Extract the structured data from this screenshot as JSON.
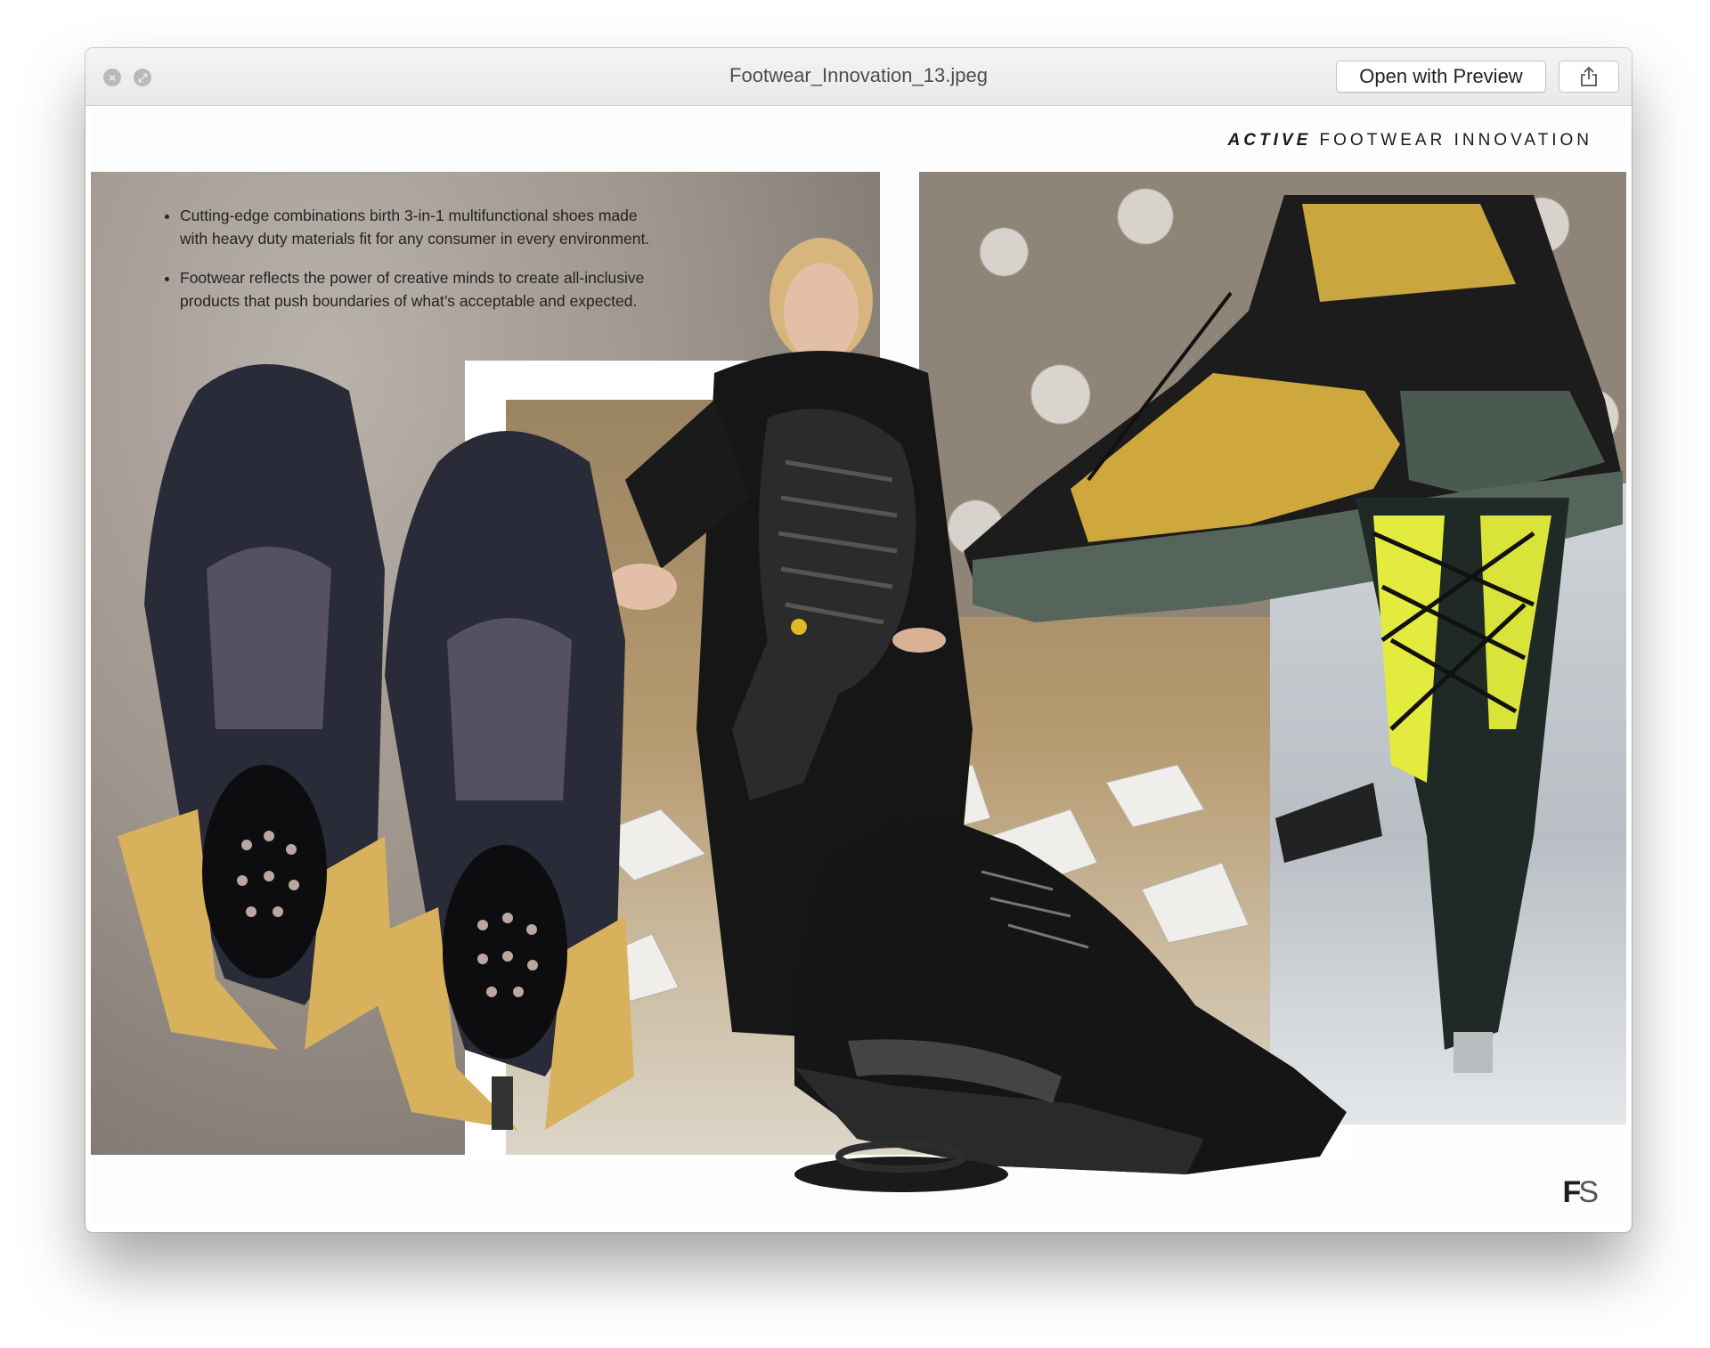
{
  "window": {
    "title": "Footwear_Innovation_13.jpeg",
    "open_button_label": "Open with Preview"
  },
  "icons": {
    "close": "close-icon",
    "fullscreen": "fullscreen-icon",
    "share": "share-icon"
  },
  "slide": {
    "heading_bold": "ACTIVE",
    "heading_rest": "FOOTWEAR INNOVATION",
    "bullets": [
      "Cutting-edge combinations birth 3-in-1 multifunctional shoes made with heavy duty materials fit for any consumer in every environment.",
      "Footwear reflects the power of creative minds to create all-inclusive products that push boundaries of what’s acceptable and expected."
    ],
    "logo": "FS"
  },
  "colors": {
    "accent_yellow": "#d8b23f",
    "boot_green": "#4c5a52",
    "neon": "#e8f24b"
  }
}
